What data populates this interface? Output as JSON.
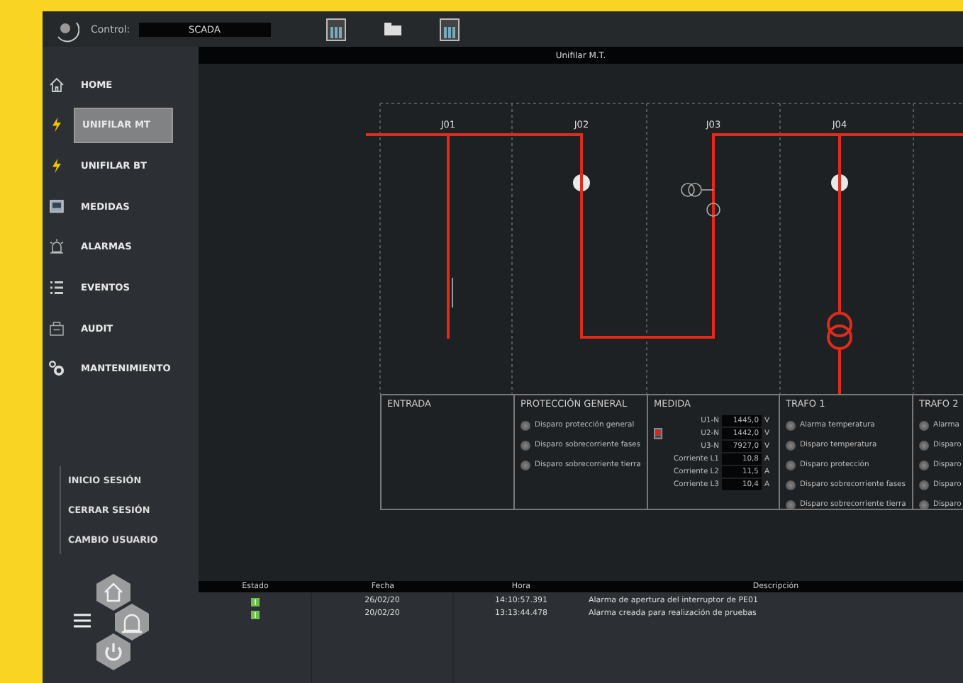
{
  "top_bar": {
    "control_label": "Control:",
    "control_value": "SCADA"
  },
  "sidebar": {
    "items": [
      {
        "label": "HOME",
        "selected": false
      },
      {
        "label": "UNIFILAR MT",
        "selected": true
      },
      {
        "label": "UNIFILAR BT",
        "selected": false
      },
      {
        "label": "MEDIDAS",
        "selected": false
      },
      {
        "label": "ALARMAS",
        "selected": false
      },
      {
        "label": "EVENTOS",
        "selected": false
      },
      {
        "label": "AUDIT",
        "selected": false
      },
      {
        "label": "MANTENIMIENTO",
        "selected": false
      }
    ],
    "session": [
      "INICIO SESIÓN",
      "CERRAR SESIÓN",
      "CAMBIO USUARIO"
    ]
  },
  "view": {
    "title": "Unifilar M.T.",
    "feeders": [
      "J01",
      "J02",
      "J03",
      "J04"
    ],
    "panels": [
      {
        "kind": "plain",
        "title": "ENTRADA"
      },
      {
        "kind": "signals",
        "title": "PROTECCIÓN GENERAL",
        "signals": [
          {
            "label": "Disparo protección general",
            "active": false
          },
          {
            "label": "Disparo sobrecorriente fases",
            "active": false
          },
          {
            "label": "Disparo sobrecorriente tierra",
            "active": false
          }
        ]
      },
      {
        "kind": "measures",
        "title": "MEDIDA",
        "measures": [
          {
            "label": "U1-N",
            "value": "1445,0",
            "unit": "V"
          },
          {
            "label": "U2-N",
            "value": "1442,0",
            "unit": "V"
          },
          {
            "label": "U3-N",
            "value": "7927,0",
            "unit": "V"
          },
          {
            "label": "Corriente L1",
            "value": "10,8",
            "unit": "A"
          },
          {
            "label": "Corriente L2",
            "value": "11,5",
            "unit": "A"
          },
          {
            "label": "Corriente L3",
            "value": "10,4",
            "unit": "A"
          }
        ]
      },
      {
        "kind": "signals",
        "title": "TRAFO 1",
        "signals": [
          {
            "label": "Alarma temperatura",
            "active": false
          },
          {
            "label": "Disparo temperatura",
            "active": false
          },
          {
            "label": "Disparo protección",
            "active": false
          },
          {
            "label": "Disparo sobrecorriente fases",
            "active": false
          },
          {
            "label": "Disparo sobrecorriente tierra",
            "active": false
          }
        ]
      },
      {
        "kind": "signals",
        "title": "TRAFO 2",
        "signals": [
          {
            "label": "Alarma",
            "active": false
          },
          {
            "label": "Disparo",
            "active": false
          },
          {
            "label": "Disparo",
            "active": false
          },
          {
            "label": "Disparo",
            "active": false
          },
          {
            "label": "Disparo",
            "active": false
          }
        ]
      }
    ]
  },
  "events": {
    "columns": [
      "Estado",
      "Fecha",
      "Hora",
      "Descripción"
    ],
    "rows": [
      {
        "ok": true,
        "date": "26/02/20",
        "time": "14:10:57.391",
        "description": "Alarma de apertura del interruptor de PE01"
      },
      {
        "ok": true,
        "date": "20/02/20",
        "time": "13:13:44.478",
        "description": "Alarma creada para realización de pruebas"
      }
    ]
  }
}
